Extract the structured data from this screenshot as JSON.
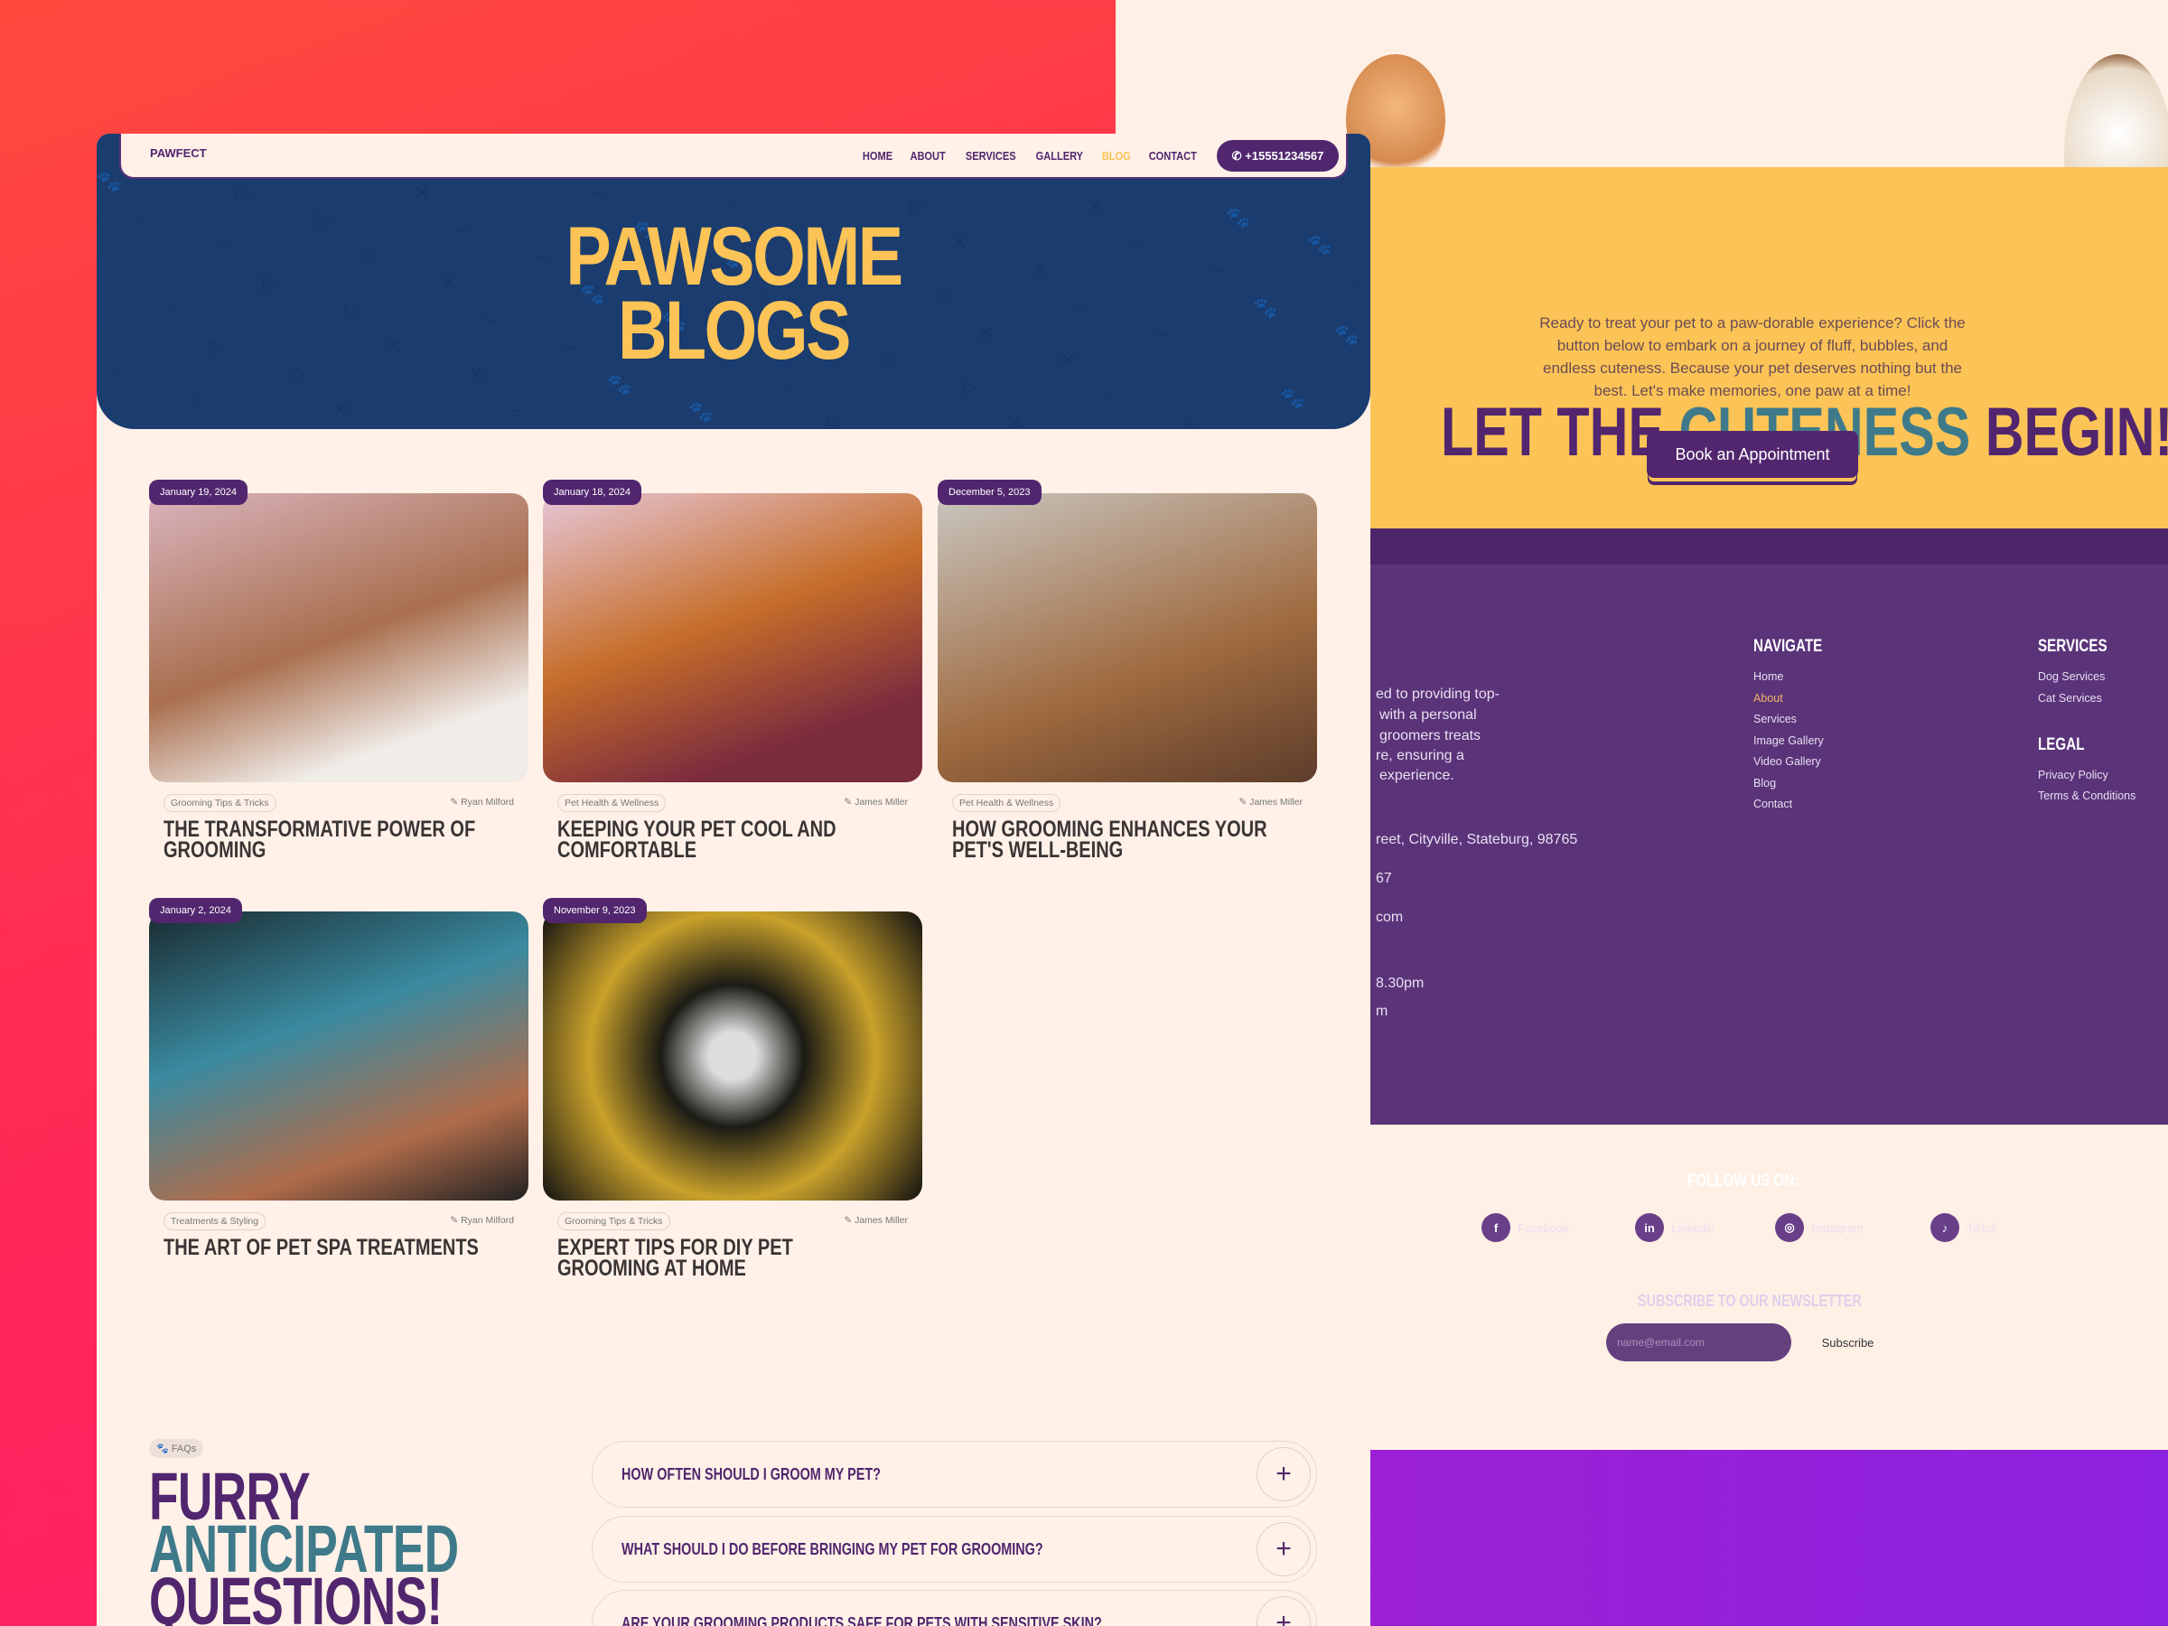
{
  "nav": {
    "logo": "PAWFECT",
    "links": [
      "HOME",
      "ABOUT",
      "SERVICES",
      "GALLERY",
      "BLOG",
      "CONTACT"
    ],
    "active": "BLOG",
    "phone": "+15551234567"
  },
  "hero": {
    "title_line1": "PAWSOME",
    "title_line2": "BLOGS"
  },
  "posts": [
    {
      "date": "January 19, 2024",
      "category": "Grooming Tips & Tricks",
      "author": "Ryan Milford",
      "title": "THE TRANSFORMATIVE POWER OF GROOMING"
    },
    {
      "date": "January 18, 2024",
      "category": "Pet Health & Wellness",
      "author": "James Miller",
      "title": "KEEPING YOUR PET COOL AND COMFORTABLE"
    },
    {
      "date": "December 5, 2023",
      "category": "Pet Health & Wellness",
      "author": "James Miller",
      "title": "HOW GROOMING ENHANCES YOUR PET'S WELL-BEING"
    },
    {
      "date": "January 2, 2024",
      "category": "Treatments & Styling",
      "author": "Ryan Milford",
      "title": "THE ART OF PET SPA TREATMENTS"
    },
    {
      "date": "November 9, 2023",
      "category": "Grooming Tips & Tricks",
      "author": "James Miller",
      "title": "EXPERT TIPS FOR DIY PET GROOMING AT HOME"
    }
  ],
  "faq": {
    "badge": "FAQs",
    "title_1": "FURRY",
    "title_2": "ANTICIPATED",
    "title_3": "QUESTIONS!",
    "questions": [
      "HOW OFTEN SHOULD I GROOM MY PET?",
      "WHAT SHOULD I DO BEFORE BRINGING MY PET FOR GROOMING?",
      "ARE YOUR GROOMING PRODUCTS SAFE FOR PETS WITH SENSITIVE SKIN?"
    ]
  },
  "cta": {
    "title_a": "LET THE ",
    "title_b": "CUTENESS",
    "title_c": " BEGIN!",
    "text": "Ready to treat your pet to a paw-dorable experience? Click the button below to embark on a journey of fluff, bubbles, and endless cuteness. Because your pet deserves nothing but the best. Let's make memories, one paw at a time!",
    "button": "Book an Appointment"
  },
  "footer": {
    "about_partial": [
      "ed to providing top-",
      "with a personal",
      "groomers treats",
      "re, ensuring a",
      "experience."
    ],
    "address_partial": "reet, Cityville, Stateburg, 98765",
    "phone_partial": "67",
    "email_partial": "com",
    "hours_partial_1": "8.30pm",
    "hours_partial_2": "m",
    "navigate": {
      "heading": "NAVIGATE",
      "links": [
        "Home",
        "About",
        "Services",
        "Image Gallery",
        "Video Gallery",
        "Blog",
        "Contact"
      ]
    },
    "services": {
      "heading": "SERVICES",
      "links": [
        "Dog Services",
        "Cat Services"
      ]
    },
    "legal": {
      "heading": "LEGAL",
      "links": [
        "Privacy Policy",
        "Terms & Conditions"
      ]
    },
    "follow": "FOLLOW US ON:",
    "socials": [
      {
        "label": "Facebook",
        "icon": "facebook-icon"
      },
      {
        "label": "Linkedin",
        "icon": "linkedin-icon"
      },
      {
        "label": "Instagram",
        "icon": "instagram-icon"
      },
      {
        "label": "Tiktok",
        "icon": "tiktok-icon"
      }
    ],
    "newsletter": {
      "heading": "SUBSCRIBE TO OUR NEWSLETTER",
      "placeholder": "name@email.com",
      "button": "Subscribe"
    }
  },
  "colors": {
    "purple": "#51266e",
    "yellow": "#fcc456",
    "navy": "#1b3c6e",
    "teal": "#3e7a8a",
    "cream": "#fff1e8"
  }
}
